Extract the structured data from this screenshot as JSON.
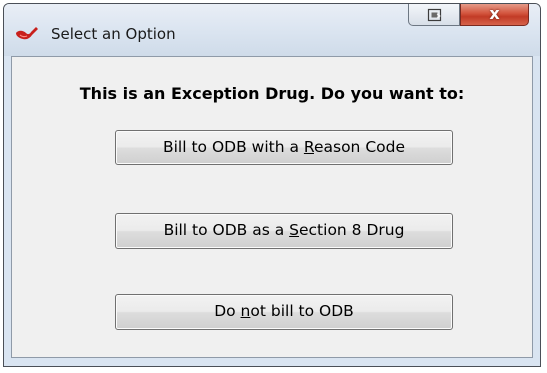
{
  "window": {
    "title": "Select an Option",
    "close_glyph": "x"
  },
  "dialog": {
    "heading": "This is an Exception Drug.  Do you want to:",
    "options": [
      {
        "pre": "Bill to ODB with a ",
        "mnemonic": "R",
        "post": "eason Code"
      },
      {
        "pre": "Bill to ODB as a ",
        "mnemonic": "S",
        "post": "ection 8 Drug"
      },
      {
        "pre": "Do ",
        "mnemonic": "n",
        "post": "ot bill to ODB"
      }
    ]
  },
  "icons": {
    "app": "red-pill-icon",
    "restore": "restore-window-icon",
    "close": "close-icon"
  },
  "colors": {
    "titlebar": "#dae4f0",
    "close_button": "#c8432e",
    "dialog_background": "#f0f0f0"
  }
}
